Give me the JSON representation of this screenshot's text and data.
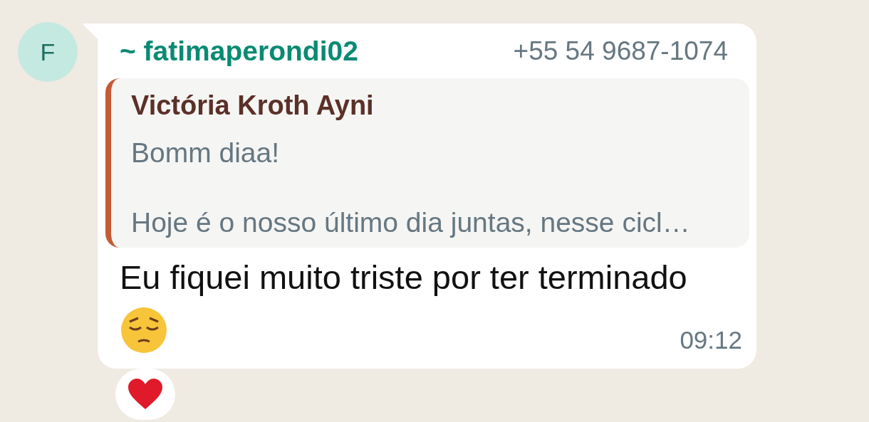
{
  "avatar": {
    "letter": "F"
  },
  "sender": {
    "name": "~ fatimaperondi02",
    "phone": "+55 54 9687-1074"
  },
  "quote": {
    "author": "Victória Kroth Ayni",
    "paragraphs": [
      "Bomm diaa!",
      "Hoje é o nosso último dia juntas, nesse cicl…"
    ]
  },
  "message": {
    "text": "Eu fiquei muito triste por ter terminado",
    "emoji": {
      "kind": "pensive"
    },
    "time": "09:12"
  },
  "reactions": [
    {
      "kind": "heart"
    }
  ]
}
